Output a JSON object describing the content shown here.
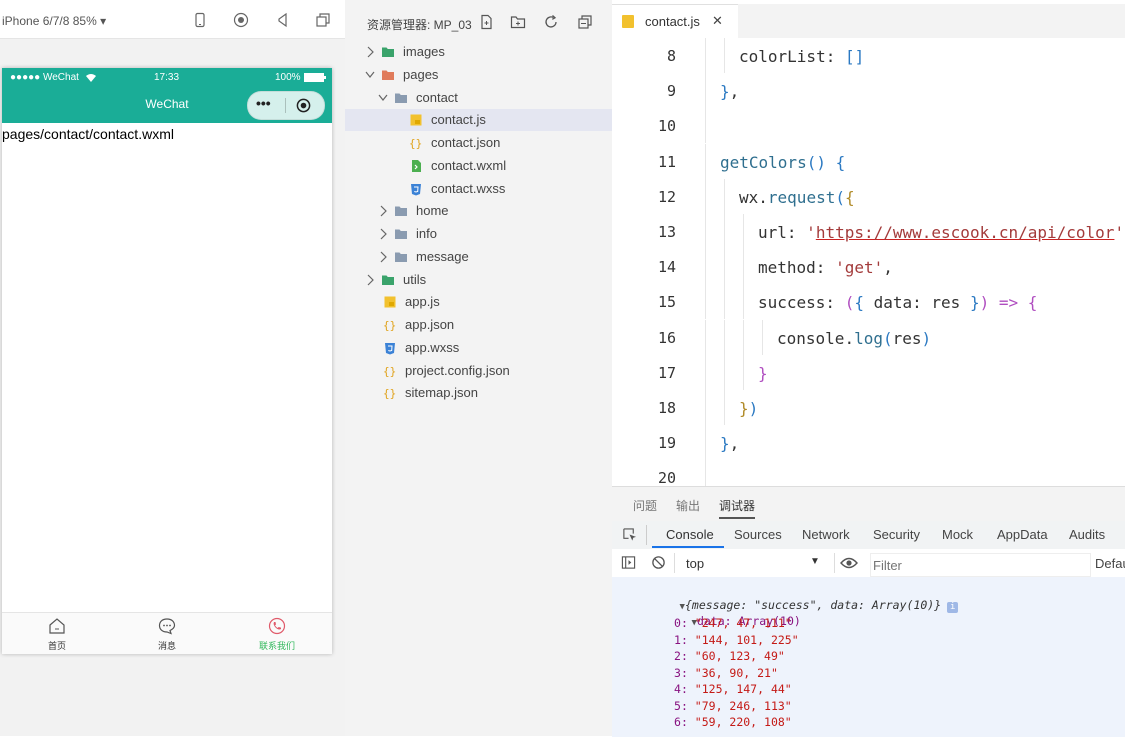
{
  "simulator": {
    "device_label": "iPhone 6/7/8 85% ▾",
    "status": {
      "carrier": "●●●●● WeChat",
      "time": "17:33",
      "battery": "100%"
    },
    "nav_title": "WeChat",
    "capsule_more": "•••",
    "page_path": "pages/contact/contact.wxml",
    "tabs": [
      {
        "label": "首页",
        "icon": "home-icon",
        "active": false
      },
      {
        "label": "消息",
        "icon": "message-icon",
        "active": false
      },
      {
        "label": "联系我们",
        "icon": "phone-icon",
        "active": true
      }
    ],
    "accent_color": "#1aad97",
    "active_tab_color": "#2fb85a"
  },
  "explorer": {
    "title": "资源管理器: MP_03",
    "tree": [
      {
        "label": "images",
        "type": "folder",
        "depth": 0,
        "expanded": false,
        "icon_color": "#3aa36b"
      },
      {
        "label": "pages",
        "type": "folder",
        "depth": 0,
        "expanded": true,
        "icon_color": "#e07b5b"
      },
      {
        "label": "contact",
        "type": "folder",
        "depth": 1,
        "expanded": true,
        "icon_color": "#8a9bb0"
      },
      {
        "label": "contact.js",
        "type": "js",
        "depth": 2,
        "selected": true
      },
      {
        "label": "contact.json",
        "type": "json",
        "depth": 2
      },
      {
        "label": "contact.wxml",
        "type": "wxml",
        "depth": 2
      },
      {
        "label": "contact.wxss",
        "type": "wxss",
        "depth": 2
      },
      {
        "label": "home",
        "type": "folder",
        "depth": 1,
        "expanded": false,
        "icon_color": "#8a9bb0"
      },
      {
        "label": "info",
        "type": "folder",
        "depth": 1,
        "expanded": false,
        "icon_color": "#8a9bb0"
      },
      {
        "label": "message",
        "type": "folder",
        "depth": 1,
        "expanded": false,
        "icon_color": "#8a9bb0"
      },
      {
        "label": "utils",
        "type": "folder",
        "depth": 0,
        "expanded": false,
        "icon_color": "#3aa36b"
      },
      {
        "label": "app.js",
        "type": "js",
        "depth": 0
      },
      {
        "label": "app.json",
        "type": "json",
        "depth": 0
      },
      {
        "label": "app.wxss",
        "type": "wxss",
        "depth": 0
      },
      {
        "label": "project.config.json",
        "type": "json",
        "depth": 0
      },
      {
        "label": "sitemap.json",
        "type": "json",
        "depth": 0
      }
    ]
  },
  "editor": {
    "tab_label": "contact.js",
    "close_glyph": "✕",
    "lines": [
      {
        "n": "8",
        "indent": 1,
        "parts": [
          [
            "colorList: ",
            "t-prop"
          ],
          [
            "[]",
            "t-br3"
          ]
        ]
      },
      {
        "n": "9",
        "indent": 0,
        "parts": [
          [
            "}",
            "t-br3"
          ],
          [
            ",",
            "t-prop"
          ]
        ]
      },
      {
        "n": "10",
        "indent": 0,
        "parts": []
      },
      {
        "n": "11",
        "indent": 0,
        "parts": [
          [
            "getColors",
            "t-fn"
          ],
          [
            "()",
            "t-br3"
          ],
          [
            " {",
            "t-br3"
          ]
        ]
      },
      {
        "n": "12",
        "indent": 1,
        "parts": [
          [
            "wx",
            "t-prop"
          ],
          [
            ".",
            "t-prop"
          ],
          [
            "request",
            "t-fn"
          ],
          [
            "(",
            "t-br3"
          ],
          [
            "{",
            "t-br1"
          ]
        ]
      },
      {
        "n": "13",
        "indent": 2,
        "parts": [
          [
            "url: ",
            "t-prop"
          ],
          [
            "'",
            "t-str"
          ],
          [
            "https://www.escook.cn/api/color",
            "t-url"
          ],
          [
            "'",
            "t-str"
          ],
          [
            ",",
            "t-prop"
          ]
        ]
      },
      {
        "n": "14",
        "indent": 2,
        "parts": [
          [
            "method: ",
            "t-prop"
          ],
          [
            "'get'",
            "t-str"
          ],
          [
            ",",
            "t-prop"
          ]
        ]
      },
      {
        "n": "15",
        "indent": 2,
        "parts": [
          [
            "success: ",
            "t-prop"
          ],
          [
            "(",
            "t-br2"
          ],
          [
            "{",
            "t-br3"
          ],
          [
            " data: res ",
            "t-prop"
          ],
          [
            "}",
            "t-br3"
          ],
          [
            ")",
            "t-br2"
          ],
          [
            " => ",
            "t-arrow"
          ],
          [
            "{",
            "t-br2"
          ]
        ]
      },
      {
        "n": "16",
        "indent": 3,
        "parts": [
          [
            "console",
            "t-prop"
          ],
          [
            ".",
            "t-prop"
          ],
          [
            "log",
            "t-fn"
          ],
          [
            "(",
            "t-br3"
          ],
          [
            "res",
            "t-prop"
          ],
          [
            ")",
            "t-br3"
          ]
        ]
      },
      {
        "n": "17",
        "indent": 2,
        "parts": [
          [
            "}",
            "t-br2"
          ]
        ]
      },
      {
        "n": "18",
        "indent": 1,
        "parts": [
          [
            "}",
            "t-br1"
          ],
          [
            ")",
            "t-br3"
          ]
        ]
      },
      {
        "n": "19",
        "indent": 0,
        "parts": [
          [
            "}",
            "t-br3"
          ],
          [
            ",",
            "t-prop"
          ]
        ]
      },
      {
        "n": "20",
        "indent": 0,
        "parts": []
      }
    ]
  },
  "panel": {
    "tabs": [
      "问题",
      "输出",
      "调试器"
    ],
    "active_tab": 2,
    "devtools_tabs": [
      "Console",
      "Sources",
      "Network",
      "Security",
      "Mock",
      "AppData",
      "Audits"
    ],
    "context": "top",
    "context_arrow": "▼",
    "filter_placeholder": "Filter",
    "levels": "Defau",
    "console": {
      "summary": "{message: \"success\", data: Array(10)}",
      "data_label": "data: Array(10)",
      "items": [
        {
          "k": "0",
          "v": "\"247, 47, 111\""
        },
        {
          "k": "1",
          "v": "\"144, 101, 225\""
        },
        {
          "k": "2",
          "v": "\"60, 123, 49\""
        },
        {
          "k": "3",
          "v": "\"36, 90, 21\""
        },
        {
          "k": "4",
          "v": "\"125, 147, 44\""
        },
        {
          "k": "5",
          "v": "\"79, 246, 113\""
        },
        {
          "k": "6",
          "v": "\"59, 220, 108\""
        }
      ]
    }
  }
}
